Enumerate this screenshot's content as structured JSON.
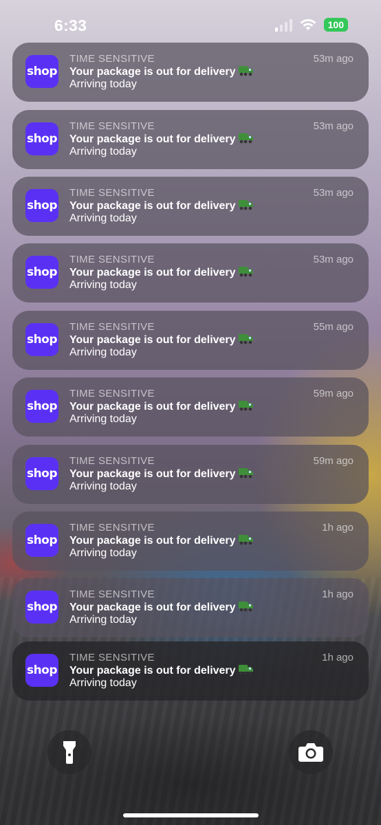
{
  "status_bar": {
    "time": "6:33",
    "battery": "100"
  },
  "notifications": [
    {
      "app_icon_text": "shop",
      "header": "TIME SENSITIVE",
      "time": "53m ago",
      "title": "Your package is out for delivery",
      "body": "Arriving today"
    },
    {
      "app_icon_text": "shop",
      "header": "TIME SENSITIVE",
      "time": "53m ago",
      "title": "Your package is out for delivery",
      "body": "Arriving today"
    },
    {
      "app_icon_text": "shop",
      "header": "TIME SENSITIVE",
      "time": "53m ago",
      "title": "Your package is out for delivery",
      "body": "Arriving today"
    },
    {
      "app_icon_text": "shop",
      "header": "TIME SENSITIVE",
      "time": "53m ago",
      "title": "Your package is out for delivery",
      "body": "Arriving today"
    },
    {
      "app_icon_text": "shop",
      "header": "TIME SENSITIVE",
      "time": "55m ago",
      "title": "Your package is out for delivery",
      "body": "Arriving today"
    },
    {
      "app_icon_text": "shop",
      "header": "TIME SENSITIVE",
      "time": "59m ago",
      "title": "Your package is out for delivery",
      "body": "Arriving today"
    },
    {
      "app_icon_text": "shop",
      "header": "TIME SENSITIVE",
      "time": "59m ago",
      "title": "Your package is out for delivery",
      "body": "Arriving today"
    },
    {
      "app_icon_text": "shop",
      "header": "TIME SENSITIVE",
      "time": "1h ago",
      "title": "Your package is out for delivery",
      "body": "Arriving today"
    },
    {
      "app_icon_text": "shop",
      "header": "TIME SENSITIVE",
      "time": "1h ago",
      "title": "Your package is out for delivery",
      "body": "Arriving today"
    },
    {
      "app_icon_text": "shop",
      "header": "TIME SENSITIVE",
      "time": "1h ago",
      "title": "Your package is out for delivery",
      "body": "Arriving today"
    }
  ],
  "icons": {
    "app": "shop-app-icon",
    "title_emoji": "delivery-truck-icon",
    "signal": "cellular-signal-icon",
    "wifi": "wifi-icon",
    "flashlight": "flashlight-icon",
    "camera": "camera-icon"
  },
  "colors": {
    "shop_brand": "#5a31f4",
    "battery_green": "#34c759",
    "truck_green": "#3f8f3a"
  }
}
